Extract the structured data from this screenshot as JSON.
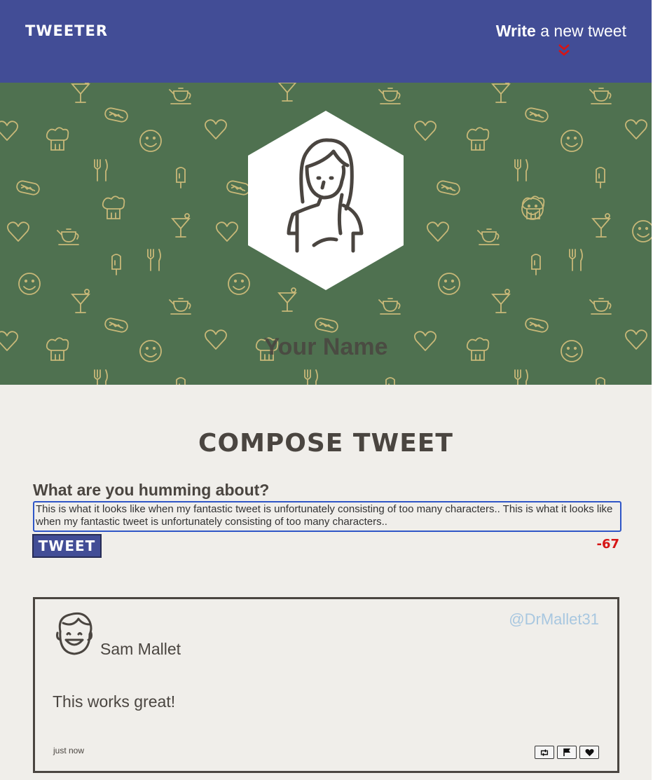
{
  "nav": {
    "brand": "TWEETER",
    "write_bold": "Write",
    "write_rest": " a new tweet",
    "chevron_icon": "double-chevron-down-icon",
    "chevron_color": "#d61515"
  },
  "hero": {
    "background_color": "#4f7150",
    "pattern_icons": [
      "cocktail-icon",
      "teapot-icon",
      "hotdog-icon",
      "smiley-icon",
      "heart-icon",
      "chef-hat-icon",
      "fork-knife-icon",
      "popsicle-icon"
    ],
    "avatar_icon": "woman-avatar-icon",
    "profile_name": "Your Name"
  },
  "compose": {
    "title": "COMPOSE TWEET",
    "prompt": "What are you humming about?",
    "text_value": "This is what it looks like when my fantastic tweet is unfortunately consisting of too many characters.. This is what it looks like when my fantastic tweet is unfortunately consisting of too many characters..",
    "button_label": "TWEET",
    "counter": "-67"
  },
  "tweets": [
    {
      "avatar_icon": "man-avatar-icon",
      "name": "Sam Mallet",
      "handle": "@DrMallet31",
      "body": "This works great!",
      "time": "just now",
      "actions": [
        "retweet-icon",
        "flag-icon",
        "heart-icon"
      ]
    }
  ],
  "colors": {
    "nav": "#424d96",
    "page": "#f0eeea",
    "text": "#4a4540",
    "handle": "#a8c7e0",
    "counter_over": "#d61515"
  }
}
